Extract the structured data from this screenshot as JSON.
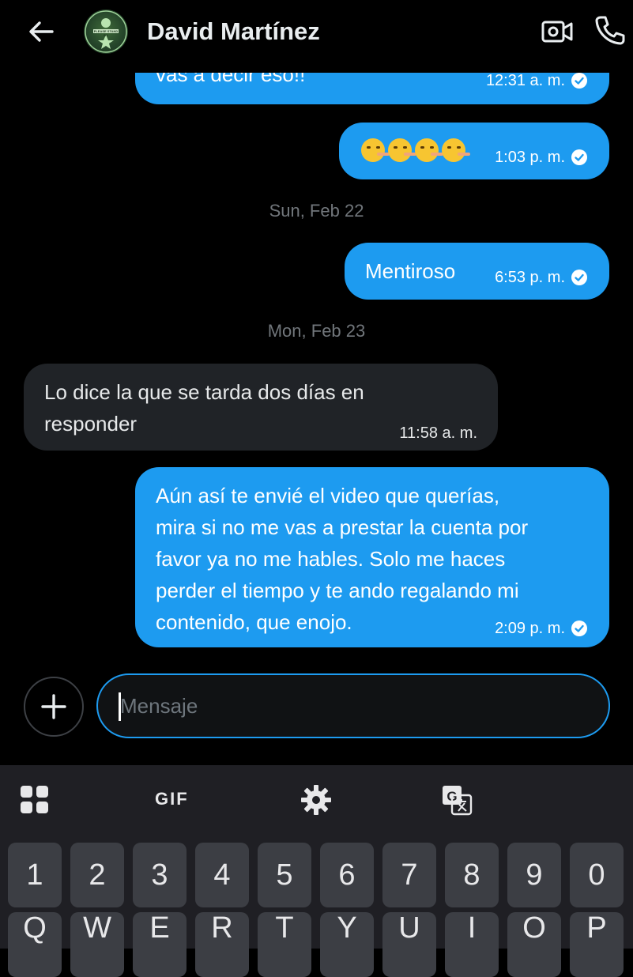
{
  "header": {
    "contact_name": "David Martínez",
    "avatar_text": "PLEASE STAND BY"
  },
  "messages": [
    {
      "id": "m1",
      "direction": "outgoing",
      "text": "vas a decir eso!!",
      "time": "12:31 a. m."
    },
    {
      "id": "m2",
      "direction": "outgoing",
      "text": "🤥🤥🤥🤥",
      "time": "1:03 p. m."
    },
    {
      "id": "m3",
      "direction": "outgoing",
      "text": "Mentiroso",
      "time": "6:53 p. m."
    },
    {
      "id": "m4",
      "direction": "incoming",
      "lines": [
        "Lo dice la que se tarda dos días en",
        "responder"
      ],
      "time": "11:58 a. m."
    },
    {
      "id": "m5",
      "direction": "outgoing",
      "lines": [
        "Aún así te envié el video que querías,",
        "mira si no me vas a prestar la cuenta por",
        "favor ya no me hables. Solo me haces",
        "perder el tiempo y te ando regalando mi",
        "contenido, que enojo."
      ],
      "time": "2:09 p. m."
    }
  ],
  "day_separators": [
    "Sun, Feb 22",
    "Mon, Feb 23"
  ],
  "composer": {
    "placeholder": "Mensaje"
  },
  "keyboard": {
    "toolbar": [
      "apps-icon",
      "GIF",
      "settings-icon",
      "translate-icon"
    ],
    "gif_label": "GIF",
    "number_row": [
      "1",
      "2",
      "3",
      "4",
      "5",
      "6",
      "7",
      "8",
      "9",
      "0"
    ],
    "letter_row": [
      "Q",
      "W",
      "E",
      "R",
      "T",
      "Y",
      "U",
      "I",
      "O",
      "P"
    ]
  },
  "colors": {
    "accent": "#1d9bf0",
    "incoming_bubble": "#202327",
    "background": "#000000"
  }
}
